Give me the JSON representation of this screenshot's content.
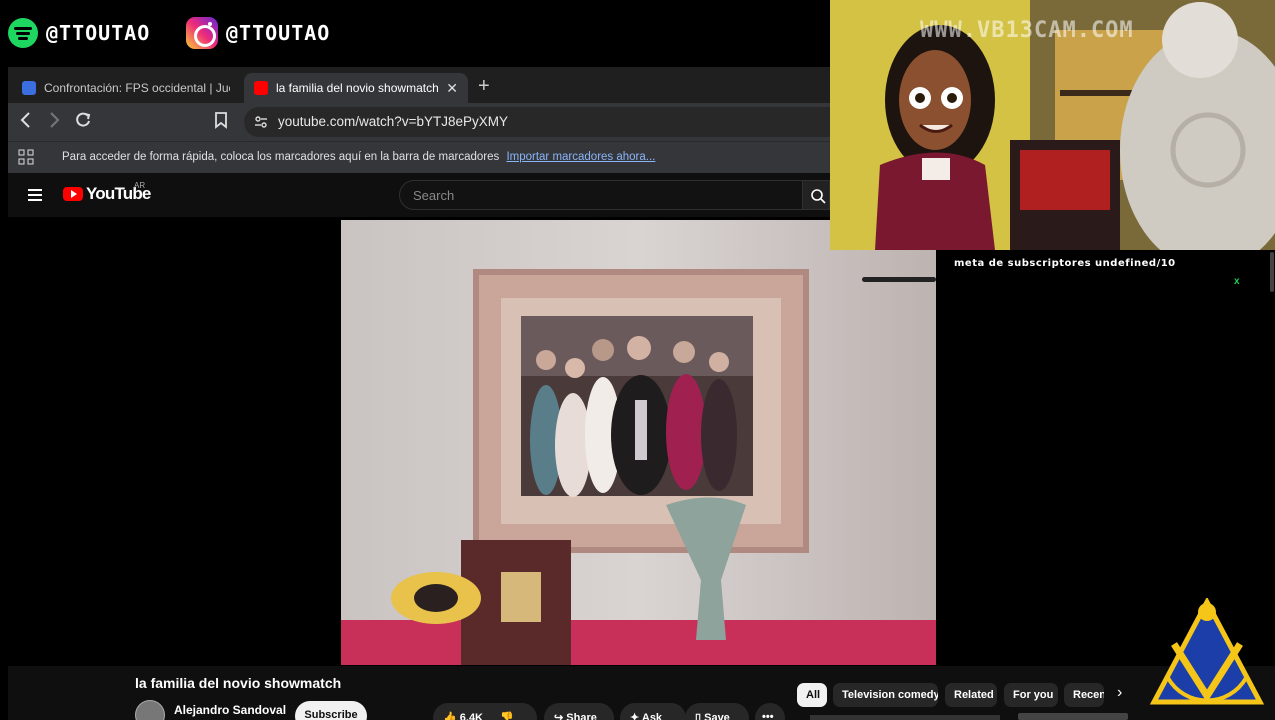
{
  "overlay": {
    "spotify_handle": "@TTOUTAO",
    "instagram_handle": "@TTOUTAO",
    "cam_watermark": "WWW.VB13CAM.COM",
    "subscriber_goal": "meta de subscriptores undefined/10",
    "goal_marker": "x"
  },
  "browser": {
    "tabs": [
      {
        "label": "Confrontación: FPS occidental | Juega",
        "active": false
      },
      {
        "label": "la familia del novio showmatch -",
        "active": true
      }
    ],
    "new_tab_symbol": "+",
    "close_symbol": "✕",
    "url": "youtube.com/watch?v=bYTJ8ePyXMY",
    "bookmarks_bar_text": "Para acceder de forma rápida, coloca los marcadores aquí en la barra de marcadores",
    "bookmarks_bar_link": "Importar marcadores ahora..."
  },
  "youtube": {
    "logo_text": "YouTube",
    "country_code": "AR",
    "search_placeholder": "Search",
    "video_title": "la familia del novio showmatch",
    "channel_name": "Alejandro Sandoval",
    "subscribe_label": "Subscribe",
    "like_count": "6.4K",
    "share_label": "Share",
    "ask_label": "Ask",
    "save_label": "Save",
    "more_symbol": "•••",
    "chips": [
      "All",
      "Television comedy",
      "Related",
      "For you",
      "Recent"
    ],
    "selected_chip": "All"
  },
  "colors": {
    "youtube_red": "#ff0000",
    "spotify_green": "#1ed760",
    "link_blue": "#8ab4f8",
    "goal_marker": "#25d04b"
  }
}
